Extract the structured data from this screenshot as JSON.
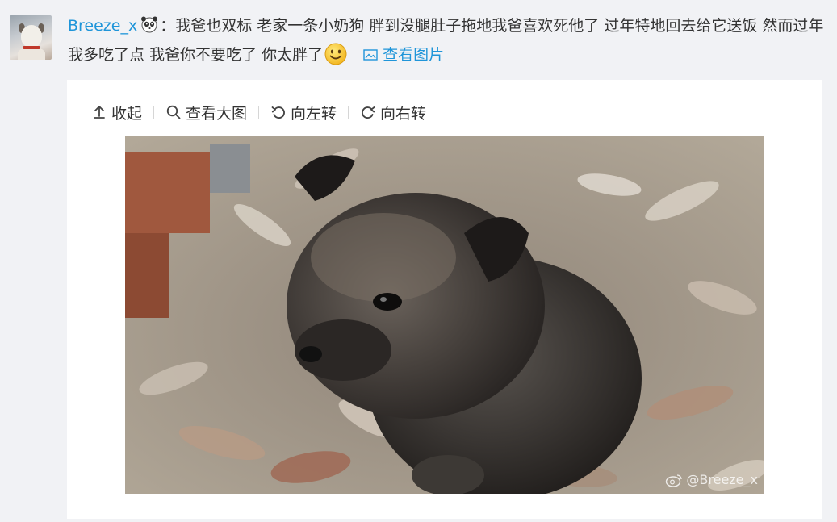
{
  "post": {
    "username": "Breeze_x",
    "username_emoji": "panda-emoji",
    "text_part1": "：我爸也双标 老家一条小奶狗 胖到没腿肚子拖地我爸喜欢死他了 过年特地回去给它送饭 然而过年我多吃了点 我爸你不要吃了 你太胖了",
    "text_emoji": "smile-emoji",
    "view_picture_label": "查看图片",
    "view_picture_icon": "picture-icon"
  },
  "media_toolbar": {
    "collapse_label": "收起",
    "collapse_icon": "arrow-up-icon",
    "view_large_label": "查看大图",
    "view_large_icon": "search-icon",
    "rotate_left_label": "向左转",
    "rotate_left_icon": "rotate-left-icon",
    "rotate_right_label": "向右转",
    "rotate_right_icon": "rotate-right-icon"
  },
  "photo": {
    "watermark": "@Breeze_x",
    "watermark_icon": "weibo-logo-icon"
  },
  "colors": {
    "link": "#1f95d9",
    "text": "#333333",
    "page_bg": "#f1f2f5",
    "card_bg": "#ffffff"
  }
}
